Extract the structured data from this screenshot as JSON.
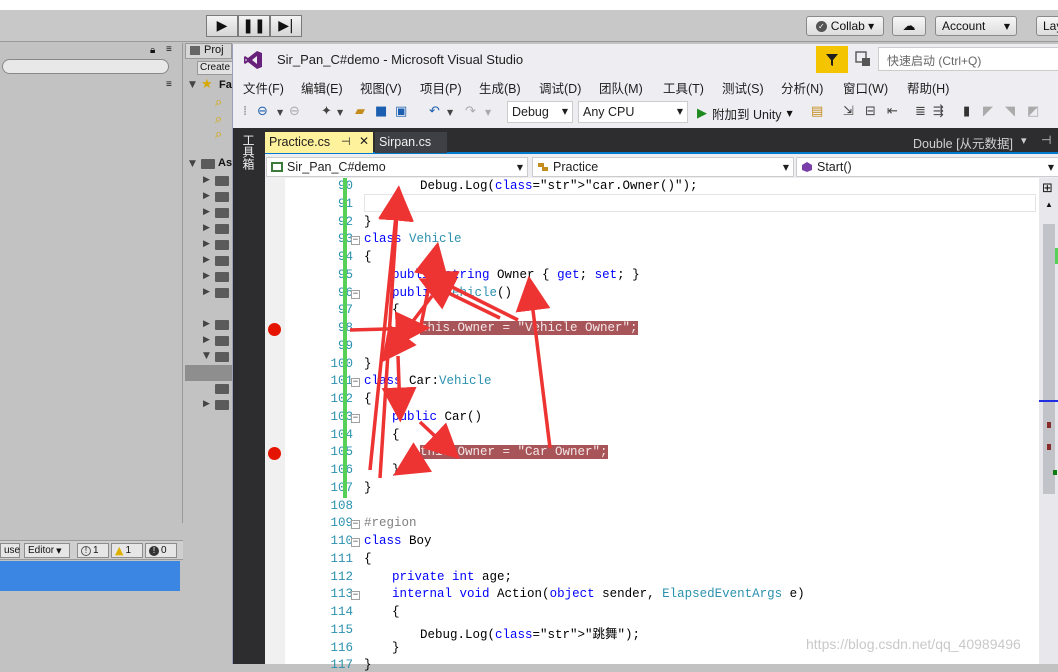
{
  "unity": {
    "collab_label": "Collab ▾",
    "account_label": "Account",
    "layout_label": "Lay",
    "project_tab": "Proj",
    "create_label": "Create",
    "fav_label": "Fa",
    "assets_label": "As",
    "console": {
      "clear_on_play": "use",
      "editor_label": "Editor",
      "info_count": "1",
      "warn_count": "1",
      "error_count": "0"
    }
  },
  "vs": {
    "title": "Sir_Pan_C#demo - Microsoft Visual Studio",
    "quick_launch_placeholder": "快速启动 (Ctrl+Q)",
    "menu": [
      "文件(F)",
      "编辑(E)",
      "视图(V)",
      "项目(P)",
      "生成(B)",
      "调试(D)",
      "团队(M)",
      "工具(T)",
      "测试(S)",
      "分析(N)",
      "窗口(W)",
      "帮助(H)"
    ],
    "toolbar": {
      "config": "Debug",
      "platform": "Any CPU",
      "attach": "附加到 Unity"
    },
    "tool_strip_label": "工具箱",
    "tabs": [
      {
        "label": "Practice.cs",
        "active": true,
        "pinned": true
      },
      {
        "label": "Sirpan.cs",
        "active": false
      }
    ],
    "right_tab_label": "Double [从元数据]",
    "nav": {
      "project": "Sir_Pan_C#demo",
      "type": "Practice",
      "member": "Start()"
    },
    "code_lines": [
      {
        "no": "90",
        "text": "Debug.Log(\"car.Owner()\");",
        "indent": 2
      },
      {
        "no": "91",
        "text": "",
        "indent": 0
      },
      {
        "no": "92",
        "text": "}",
        "indent": 0
      },
      {
        "no": "93",
        "text": "class Vehicle",
        "indent": 0
      },
      {
        "no": "94",
        "text": "{",
        "indent": 0
      },
      {
        "no": "95",
        "text": "public string Owner { get; set; }",
        "indent": 1
      },
      {
        "no": "96",
        "text": "public Vehicle()",
        "indent": 1
      },
      {
        "no": "97",
        "text": "{",
        "indent": 1
      },
      {
        "no": "98",
        "text": "this.Owner = \"Vehicle Owner\";",
        "indent": 2,
        "breakpoint": true
      },
      {
        "no": "99",
        "text": "}",
        "indent": 1
      },
      {
        "no": "100",
        "text": "}",
        "indent": 0
      },
      {
        "no": "101",
        "text": "class Car:Vehicle",
        "indent": 0
      },
      {
        "no": "102",
        "text": "{",
        "indent": 0
      },
      {
        "no": "103",
        "text": "public Car()",
        "indent": 1
      },
      {
        "no": "104",
        "text": "{",
        "indent": 1
      },
      {
        "no": "105",
        "text": "this.Owner = \"Car Owner\";",
        "indent": 2,
        "breakpoint": true
      },
      {
        "no": "106",
        "text": "}",
        "indent": 1
      },
      {
        "no": "107",
        "text": "}",
        "indent": 0
      },
      {
        "no": "108",
        "text": "",
        "indent": 0
      },
      {
        "no": "109",
        "text": "#region",
        "indent": 0
      },
      {
        "no": "110",
        "text": "class Boy",
        "indent": 0
      },
      {
        "no": "111",
        "text": "{",
        "indent": 0
      },
      {
        "no": "112",
        "text": "private int age;",
        "indent": 1
      },
      {
        "no": "113",
        "text": "internal void Action(object sender, ElapsedEventArgs e)",
        "indent": 1
      },
      {
        "no": "114",
        "text": "{",
        "indent": 1
      },
      {
        "no": "115",
        "text": "Debug.Log(\"跳舞\");",
        "indent": 2
      },
      {
        "no": "116",
        "text": "}",
        "indent": 1
      },
      {
        "no": "117",
        "text": "}",
        "indent": 0
      }
    ]
  },
  "watermark": "https://blog.csdn.net/qq_40989496",
  "colors": {
    "accent": "#007acc",
    "breakpoint": "#e51400",
    "highlight": "#a8555a",
    "arrow": "#ee3333",
    "filter": "#f5c400"
  }
}
